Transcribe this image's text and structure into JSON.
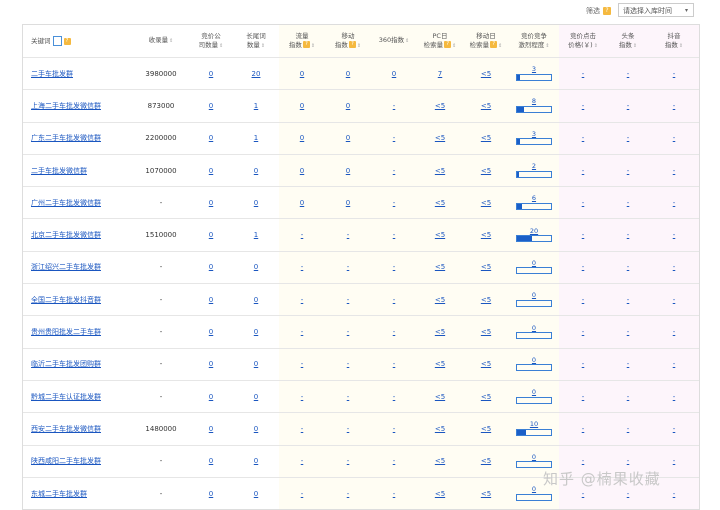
{
  "toolbar": {
    "filter_label": "筛选",
    "filter_badge": "?",
    "select_placeholder": "请选择入库时间",
    "select_arrow": "▾"
  },
  "columns": [
    {
      "key": "keyword",
      "line1": "关键词",
      "line2": ""
    },
    {
      "key": "volume",
      "line1": "收录量",
      "line2": ""
    },
    {
      "key": "bid_companies",
      "line1": "竞价公",
      "line2": "司数量"
    },
    {
      "key": "longtail",
      "line1": "长尾词",
      "line2": "数量"
    },
    {
      "key": "traffic_index",
      "line1": "流量",
      "line2": "指数"
    },
    {
      "key": "mobile_index",
      "line1": "移动",
      "line2": "指数"
    },
    {
      "key": "index_360",
      "line1": "360指数",
      "line2": ""
    },
    {
      "key": "pc_daily",
      "line1": "PC日",
      "line2": "检索量"
    },
    {
      "key": "mobile_daily",
      "line1": "移动日",
      "line2": "检索量"
    },
    {
      "key": "competition",
      "line1": "竞价竞争",
      "line2": "激烈程度"
    },
    {
      "key": "cpc",
      "line1": "竞价点击",
      "line2": "价格(￥)"
    },
    {
      "key": "toutiao",
      "line1": "头条",
      "line2": "指数"
    },
    {
      "key": "douyin",
      "line1": "抖音",
      "line2": "指数"
    }
  ],
  "rows": [
    {
      "keyword": "二手车批发群",
      "volume": "3980000",
      "bid_companies": "0",
      "longtail": "20",
      "traffic_index": "0",
      "mobile_index": "0",
      "index_360": "0",
      "pc_daily": "7",
      "mobile_daily": "<5",
      "competition": "3",
      "competition_fill": 0.08,
      "cpc": "-",
      "toutiao": "-",
      "douyin": "-"
    },
    {
      "keyword": "上海二手车批发微信群",
      "volume": "873000",
      "bid_companies": "0",
      "longtail": "1",
      "traffic_index": "0",
      "mobile_index": "0",
      "index_360": "-",
      "pc_daily": "<5",
      "mobile_daily": "<5",
      "competition": "8",
      "competition_fill": 0.2,
      "cpc": "-",
      "toutiao": "-",
      "douyin": "-"
    },
    {
      "keyword": "广东二手车批发微信群",
      "volume": "2200000",
      "bid_companies": "0",
      "longtail": "1",
      "traffic_index": "0",
      "mobile_index": "0",
      "index_360": "-",
      "pc_daily": "<5",
      "mobile_daily": "<5",
      "competition": "3",
      "competition_fill": 0.08,
      "cpc": "-",
      "toutiao": "-",
      "douyin": "-"
    },
    {
      "keyword": "二手车批发微信群",
      "volume": "1070000",
      "bid_companies": "0",
      "longtail": "0",
      "traffic_index": "0",
      "mobile_index": "0",
      "index_360": "-",
      "pc_daily": "<5",
      "mobile_daily": "<5",
      "competition": "2",
      "competition_fill": 0.06,
      "cpc": "-",
      "toutiao": "-",
      "douyin": "-"
    },
    {
      "keyword": "广州二手车批发微信群",
      "volume": "-",
      "bid_companies": "0",
      "longtail": "0",
      "traffic_index": "0",
      "mobile_index": "0",
      "index_360": "-",
      "pc_daily": "<5",
      "mobile_daily": "<5",
      "competition": "6",
      "competition_fill": 0.15,
      "cpc": "-",
      "toutiao": "-",
      "douyin": "-"
    },
    {
      "keyword": "北京二手车批发微信群",
      "volume": "1510000",
      "bid_companies": "0",
      "longtail": "1",
      "traffic_index": "-",
      "mobile_index": "-",
      "index_360": "-",
      "pc_daily": "<5",
      "mobile_daily": "<5",
      "competition": "20",
      "competition_fill": 0.45,
      "cpc": "-",
      "toutiao": "-",
      "douyin": "-"
    },
    {
      "keyword": "浙江绍兴二手车批发群",
      "volume": "-",
      "bid_companies": "0",
      "longtail": "0",
      "traffic_index": "-",
      "mobile_index": "-",
      "index_360": "-",
      "pc_daily": "<5",
      "mobile_daily": "<5",
      "competition": "0",
      "competition_fill": 0,
      "cpc": "-",
      "toutiao": "-",
      "douyin": "-"
    },
    {
      "keyword": "全国二手车批发抖音群",
      "volume": "-",
      "bid_companies": "0",
      "longtail": "0",
      "traffic_index": "-",
      "mobile_index": "-",
      "index_360": "-",
      "pc_daily": "<5",
      "mobile_daily": "<5",
      "competition": "0",
      "competition_fill": 0,
      "cpc": "-",
      "toutiao": "-",
      "douyin": "-"
    },
    {
      "keyword": "贵州贵阳批发二手车群",
      "volume": "-",
      "bid_companies": "0",
      "longtail": "0",
      "traffic_index": "-",
      "mobile_index": "-",
      "index_360": "-",
      "pc_daily": "<5",
      "mobile_daily": "<5",
      "competition": "0",
      "competition_fill": 0,
      "cpc": "-",
      "toutiao": "-",
      "douyin": "-"
    },
    {
      "keyword": "临沂二手车批发团购群",
      "volume": "-",
      "bid_companies": "0",
      "longtail": "0",
      "traffic_index": "-",
      "mobile_index": "-",
      "index_360": "-",
      "pc_daily": "<5",
      "mobile_daily": "<5",
      "competition": "0",
      "competition_fill": 0,
      "cpc": "-",
      "toutiao": "-",
      "douyin": "-"
    },
    {
      "keyword": "黔城二手车认证批发群",
      "volume": "-",
      "bid_companies": "0",
      "longtail": "0",
      "traffic_index": "-",
      "mobile_index": "-",
      "index_360": "-",
      "pc_daily": "<5",
      "mobile_daily": "<5",
      "competition": "0",
      "competition_fill": 0,
      "cpc": "-",
      "toutiao": "-",
      "douyin": "-"
    },
    {
      "keyword": "西安二手车批发微信群",
      "volume": "1480000",
      "bid_companies": "0",
      "longtail": "0",
      "traffic_index": "-",
      "mobile_index": "-",
      "index_360": "-",
      "pc_daily": "<5",
      "mobile_daily": "<5",
      "competition": "10",
      "competition_fill": 0.25,
      "cpc": "-",
      "toutiao": "-",
      "douyin": "-"
    },
    {
      "keyword": "陕西咸阳二手车批发群",
      "volume": "-",
      "bid_companies": "0",
      "longtail": "0",
      "traffic_index": "-",
      "mobile_index": "-",
      "index_360": "-",
      "pc_daily": "<5",
      "mobile_daily": "<5",
      "competition": "0",
      "competition_fill": 0,
      "cpc": "-",
      "toutiao": "-",
      "douyin": "-"
    },
    {
      "keyword": "东城二手车批发群",
      "volume": "-",
      "bid_companies": "0",
      "longtail": "0",
      "traffic_index": "-",
      "mobile_index": "-",
      "index_360": "-",
      "pc_daily": "<5",
      "mobile_daily": "<5",
      "competition": "0",
      "competition_fill": 0,
      "cpc": "-",
      "toutiao": "-",
      "douyin": "-"
    }
  ],
  "watermark": "知乎 @楠果收藏",
  "colors": {
    "link": "#1a56c0",
    "bar_fill": "#1a5fc8",
    "badge": "#f5b93f"
  }
}
